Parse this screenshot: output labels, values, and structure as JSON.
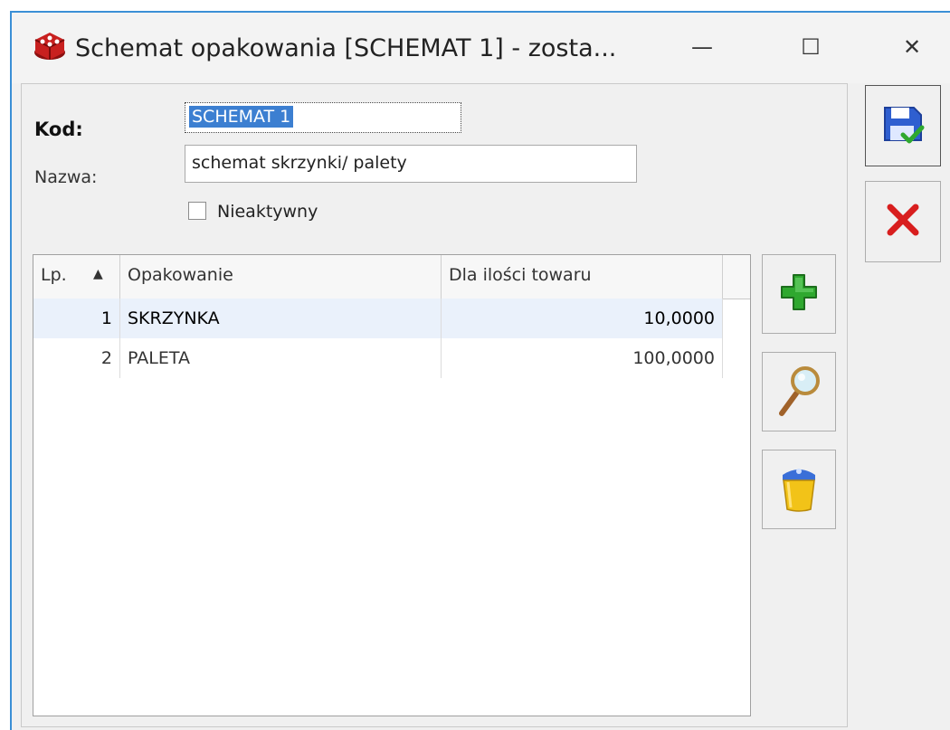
{
  "window": {
    "title": "Schemat opakowania [SCHEMAT 1] - zosta...",
    "controls": {
      "minimize": "—",
      "maximize": "☐",
      "close": "✕"
    }
  },
  "form": {
    "kod_label": "Kod:",
    "kod_value": "SCHEMAT 1",
    "nazwa_label": "Nazwa:",
    "nazwa_value": "schemat skrzynki/ palety",
    "nieaktywny_label": "Nieaktywny",
    "nieaktywny_checked": false
  },
  "grid": {
    "columns": [
      "Lp.",
      "Opakowanie",
      "Dla ilości towaru"
    ],
    "sort_indicator": "▲",
    "rows": [
      {
        "lp": "1",
        "opakowanie": "SKRZYNKA",
        "ilosc": "10,0000",
        "selected": true
      },
      {
        "lp": "2",
        "opakowanie": "PALETA",
        "ilosc": "100,0000",
        "selected": false
      }
    ]
  },
  "icons": {
    "app": "crate-icon",
    "add": "plus-icon",
    "view": "magnifier-icon",
    "delete": "trash-bin-icon",
    "save": "save-icon",
    "cancel": "cancel-icon"
  },
  "colors": {
    "accent_border": "#3b8fd6",
    "selection": "#3c7fd1",
    "add_green": "#2fa82f",
    "cancel_red": "#d81e1e"
  }
}
